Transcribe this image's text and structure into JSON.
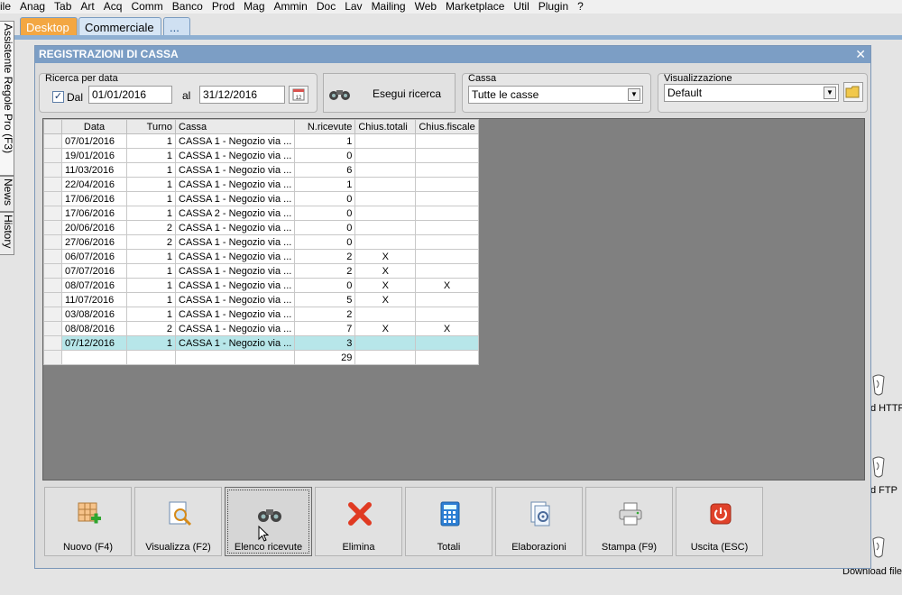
{
  "menubar": [
    "ile",
    "Anag",
    "Tab",
    "Art",
    "Acq",
    "Comm",
    "Banco",
    "Prod",
    "Mag",
    "Ammin",
    "Doc",
    "Lav",
    "Mailing",
    "Web",
    "Marketplace",
    "Util",
    "Plugin",
    "?"
  ],
  "side_tabs": [
    "Assistente Regole Pro (F3)",
    "News",
    "History"
  ],
  "tabs": {
    "desktop": "Desktop",
    "commerciale": "Commerciale",
    "more": "..."
  },
  "desktop_icons": {
    "http": "d HTTP",
    "ftp": "d FTP",
    "file": "Download file"
  },
  "window": {
    "title": "REGISTRAZIONI DI CASSA",
    "date_group": {
      "label": "Ricerca per data",
      "checkbox_label": "Dal",
      "checked": true,
      "from": "01/01/2016",
      "to_label": "al",
      "to": "31/12/2016"
    },
    "search_button": "Esegui ricerca",
    "cassa_group": {
      "label": "Cassa",
      "value": "Tutte le casse"
    },
    "view_group": {
      "label": "Visualizzazione",
      "value": "Default"
    }
  },
  "grid": {
    "headers": [
      "Data",
      "Turno",
      "Cassa",
      "N.ricevute",
      "Chius.totali",
      "Chius.fiscale"
    ],
    "rows": [
      [
        "07/01/2016",
        "1",
        "CASSA 1 - Negozio via ...",
        "1",
        "",
        ""
      ],
      [
        "19/01/2016",
        "1",
        "CASSA 1 - Negozio via ...",
        "0",
        "",
        ""
      ],
      [
        "11/03/2016",
        "1",
        "CASSA 1 - Negozio via ...",
        "6",
        "",
        ""
      ],
      [
        "22/04/2016",
        "1",
        "CASSA 1 - Negozio via ...",
        "1",
        "",
        ""
      ],
      [
        "17/06/2016",
        "1",
        "CASSA 1 - Negozio via ...",
        "0",
        "",
        ""
      ],
      [
        "17/06/2016",
        "1",
        "CASSA 2 - Negozio via ...",
        "0",
        "",
        ""
      ],
      [
        "20/06/2016",
        "2",
        "CASSA 1 - Negozio via ...",
        "0",
        "",
        ""
      ],
      [
        "27/06/2016",
        "2",
        "CASSA 1 - Negozio via ...",
        "0",
        "",
        ""
      ],
      [
        "06/07/2016",
        "1",
        "CASSA 1 - Negozio via ...",
        "2",
        "X",
        ""
      ],
      [
        "07/07/2016",
        "1",
        "CASSA 1 - Negozio via ...",
        "2",
        "X",
        ""
      ],
      [
        "08/07/2016",
        "1",
        "CASSA 1 - Negozio via ...",
        "0",
        "X",
        "X"
      ],
      [
        "11/07/2016",
        "1",
        "CASSA 1 - Negozio via ...",
        "5",
        "X",
        ""
      ],
      [
        "03/08/2016",
        "1",
        "CASSA 1 - Negozio via ...",
        "2",
        "",
        ""
      ],
      [
        "08/08/2016",
        "2",
        "CASSA 1 - Negozio via ...",
        "7",
        "X",
        "X"
      ],
      [
        "07/12/2016",
        "1",
        "CASSA 1 - Negozio via ...",
        "3",
        "",
        ""
      ]
    ],
    "selected_row": 14,
    "total": "29"
  },
  "buttons": [
    "Nuovo (F4)",
    "Visualizza (F2)",
    "Elenco ricevute",
    "Elimina",
    "Totali",
    "Elaborazioni",
    "Stampa (F9)",
    "Uscita (ESC)"
  ]
}
